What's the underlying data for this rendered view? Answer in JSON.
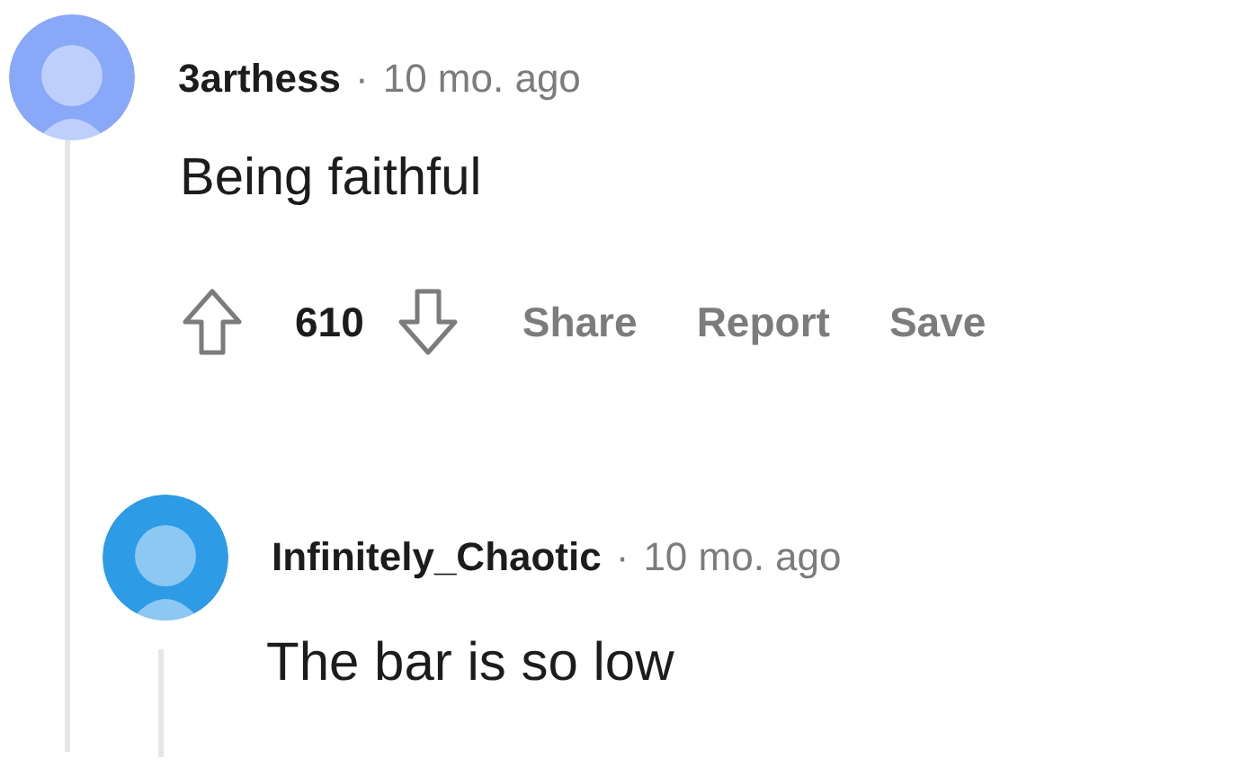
{
  "comments": [
    {
      "author": "3arthess",
      "separator": "·",
      "time": "10 mo. ago",
      "color": "#8aa8f8",
      "body": "Being faithful",
      "score": "610",
      "actions": [
        "Share",
        "Report",
        "Save"
      ]
    },
    {
      "author": "Infinitely_Chaotic",
      "separator": "·",
      "time": "10 mo. ago",
      "color": "#2e9be6",
      "body": "The bar is so low"
    }
  ]
}
